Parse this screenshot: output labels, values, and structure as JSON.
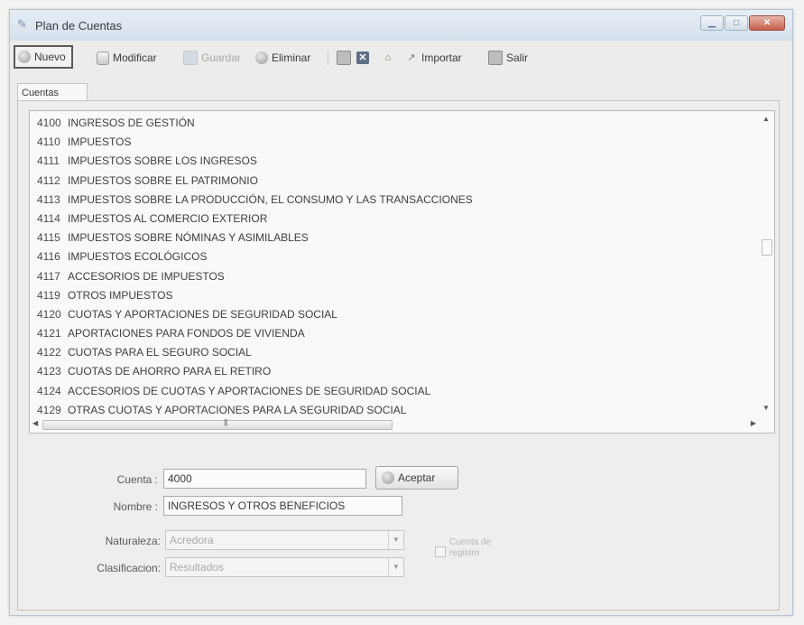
{
  "window": {
    "title": "Plan de Cuentas"
  },
  "toolbar": {
    "nuevo": "Nuevo",
    "modificar": "Modificar",
    "guardar": "Guardar",
    "eliminar": "Eliminar",
    "importar": "Importar",
    "salir": "Salir"
  },
  "tabs": {
    "cuentas": "Cuentas"
  },
  "accounts": [
    {
      "code": "4100",
      "name": "INGRESOS DE GESTIÓN"
    },
    {
      "code": "4110",
      "name": "IMPUESTOS"
    },
    {
      "code": "4111",
      "name": "IMPUESTOS SOBRE LOS INGRESOS"
    },
    {
      "code": "4112",
      "name": "IMPUESTOS SOBRE EL PATRIMONIO"
    },
    {
      "code": "4113",
      "name": "IMPUESTOS SOBRE LA PRODUCCIÓN, EL CONSUMO Y LAS TRANSACCIONES"
    },
    {
      "code": "4114",
      "name": "IMPUESTOS AL COMERCIO EXTERIOR"
    },
    {
      "code": "4115",
      "name": "IMPUESTOS SOBRE NÓMINAS Y ASIMILABLES"
    },
    {
      "code": "4116",
      "name": "IMPUESTOS ECOLÓGICOS"
    },
    {
      "code": "4117",
      "name": "ACCESORIOS DE IMPUESTOS"
    },
    {
      "code": "4119",
      "name": "OTROS IMPUESTOS"
    },
    {
      "code": "4120",
      "name": "CUOTAS Y APORTACIONES DE SEGURIDAD SOCIAL"
    },
    {
      "code": "4121",
      "name": "APORTACIONES PARA FONDOS DE VIVIENDA"
    },
    {
      "code": "4122",
      "name": "CUOTAS PARA EL SEGURO SOCIAL"
    },
    {
      "code": "4123",
      "name": "CUOTAS DE AHORRO PARA EL RETIRO"
    },
    {
      "code": "4124",
      "name": "ACCESORIOS DE CUOTAS Y APORTACIONES DE SEGURIDAD SOCIAL"
    },
    {
      "code": "4129",
      "name": "OTRAS CUOTAS Y APORTACIONES PARA LA SEGURIDAD SOCIAL"
    }
  ],
  "form": {
    "cuenta_label": "Cuenta :",
    "cuenta_value": "4000",
    "aceptar": "Aceptar",
    "nombre_label": "Nombre :",
    "nombre_value": "INGRESOS Y OTROS BENEFICIOS",
    "naturaleza_label": "Naturaleza:",
    "naturaleza_value": "Acredora",
    "clasificacion_label": "Clasificacion:",
    "clasificacion_value": "Resultados",
    "cuenta_registro_label": "Cuenta de registro"
  }
}
